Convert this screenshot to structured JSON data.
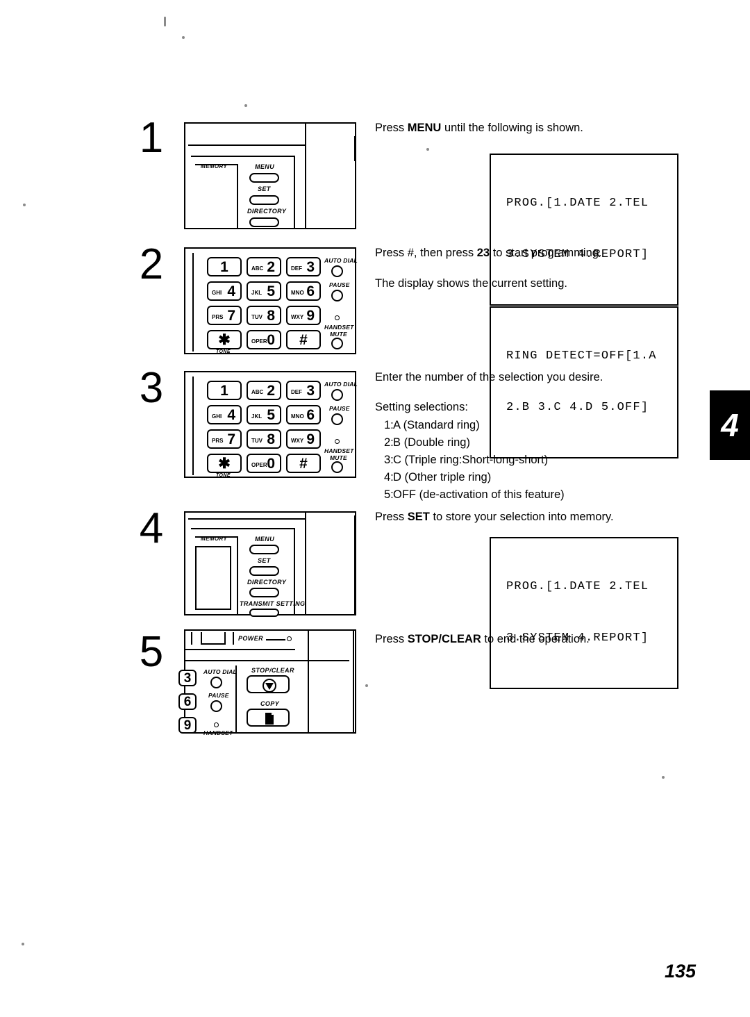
{
  "page": {
    "number": "135",
    "chapter_tab": "4"
  },
  "steps": [
    {
      "num": "1",
      "instruction_pre": "Press ",
      "instruction_bold": "MENU",
      "instruction_post": " until the following is shown.",
      "lcd_line1": "PROG.[1.DATE 2.TEL",
      "lcd_line2": "3.SYSTEM 4.REPORT]"
    },
    {
      "num": "2",
      "instruction_pre": "Press #, then press ",
      "instruction_bold": "23",
      "instruction_post": " to start programming.",
      "instruction2": "The display shows the current setting.",
      "lcd_line1": "RING DETECT=OFF[1.A",
      "lcd_line2": "2.B 3.C 4.D 5.OFF]"
    },
    {
      "num": "3",
      "instruction": "Enter the number of the selection you desire.",
      "selections_title": "Setting selections:",
      "selections": [
        {
          "key": "1:",
          "label": "A (Standard ring)"
        },
        {
          "key": "2:",
          "label": "B (Double ring)"
        },
        {
          "key": "3:",
          "label": "C (Triple ring:Short-long-short)"
        },
        {
          "key": "4:",
          "label": "D (Other triple ring)"
        },
        {
          "key": "5:",
          "label": "OFF (de-activation of this feature)"
        }
      ]
    },
    {
      "num": "4",
      "instruction_pre": "Press ",
      "instruction_bold": "SET",
      "instruction_post": " to store your selection into memory.",
      "lcd_line1": "PROG.[1.DATE 2.TEL",
      "lcd_line2": "3.SYSTEM 4.REPORT]"
    },
    {
      "num": "5",
      "instruction_pre": "Press ",
      "instruction_bold": "STOP/CLEAR",
      "instruction_post": " to end the operation.",
      "lcd_line1": "",
      "lcd_line2": ""
    }
  ],
  "panel": {
    "memory_label": "MEMORY",
    "menu_label": "MENU",
    "set_label": "SET",
    "directory_label": "DIRECTORY",
    "transmit_setting_label": "TRANSMIT SETTING",
    "power_label": "POWER",
    "stop_clear_label": "STOP/CLEAR",
    "copy_label": "COPY",
    "auto_dial_label": "AUTO DIAL",
    "pause_label": "PAUSE",
    "handset_label": "HANDSET",
    "mute_label": "MUTE",
    "tone_label": "TONE"
  },
  "keypad": {
    "keys": [
      {
        "digit": "1",
        "alpha": ""
      },
      {
        "digit": "2",
        "alpha": "ABC"
      },
      {
        "digit": "3",
        "alpha": "DEF"
      },
      {
        "digit": "4",
        "alpha": "GHI"
      },
      {
        "digit": "5",
        "alpha": "JKL"
      },
      {
        "digit": "6",
        "alpha": "MNO"
      },
      {
        "digit": "7",
        "alpha": "PRS"
      },
      {
        "digit": "8",
        "alpha": "TUV"
      },
      {
        "digit": "9",
        "alpha": "WXY"
      },
      {
        "digit": "✱",
        "alpha": ""
      },
      {
        "digit": "0",
        "alpha": "OPER"
      },
      {
        "digit": "#",
        "alpha": ""
      }
    ],
    "partial_keys": [
      "3",
      "6",
      "9"
    ]
  }
}
